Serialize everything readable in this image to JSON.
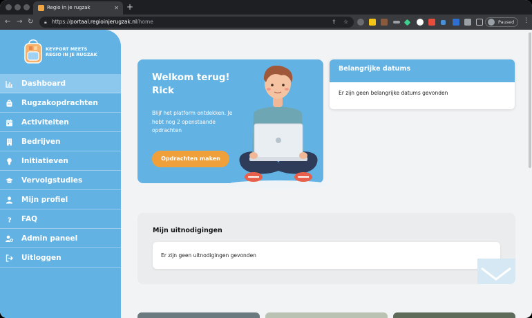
{
  "browser": {
    "tab_title": "Regio in je rugzak",
    "url_scheme": "https://",
    "url_host": "portaal.regioinjerugzak.nl",
    "url_path": "/home",
    "profile_status": "Paused"
  },
  "sidebar": {
    "logo_line1": "KEYPORT MEETS",
    "logo_line2": "REGIO IN JE RUGZAK",
    "items": [
      {
        "label": "Dashboard",
        "icon": "chart-icon",
        "active": true
      },
      {
        "label": "Rugzakopdrachten",
        "icon": "backpack-icon"
      },
      {
        "label": "Activiteiten",
        "icon": "calendar-icon"
      },
      {
        "label": "Bedrijven",
        "icon": "building-icon"
      },
      {
        "label": "Initiatieven",
        "icon": "lightbulb-icon"
      },
      {
        "label": "Vervolgstudies",
        "icon": "graduation-cap-icon"
      },
      {
        "label": "Mijn profiel",
        "icon": "user-icon"
      },
      {
        "label": "FAQ",
        "icon": "question-icon"
      },
      {
        "label": "Admin paneel",
        "icon": "user-gear-icon"
      },
      {
        "label": "Uitloggen",
        "icon": "logout-icon"
      }
    ]
  },
  "welcome": {
    "title": "Welkom terug!",
    "name": "Rick",
    "text": "Blijf het platform ontdekken. Je hebt nog 2 openstaande opdrachten",
    "button": "Opdrachten maken"
  },
  "dates": {
    "title": "Belangrijke datums",
    "empty_text": "Er zijn geen belangrijke datums gevonden"
  },
  "invitations": {
    "title": "Mijn uitnodigingen",
    "empty_text": "Er zijn geen uitnodigingen gevonden"
  },
  "colors": {
    "brand_blue": "#62b2e4",
    "accent_orange": "#f0a03a"
  }
}
